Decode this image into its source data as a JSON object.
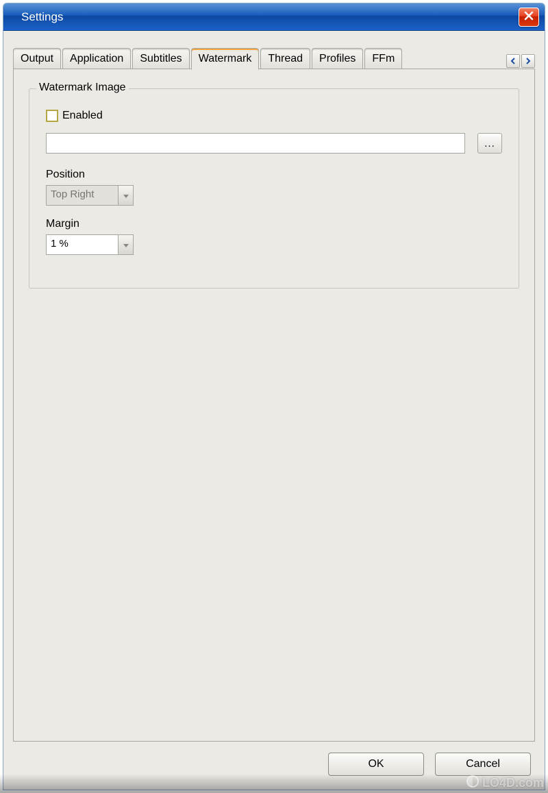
{
  "window": {
    "title": "Settings"
  },
  "tabs": {
    "items": [
      {
        "label": "Output"
      },
      {
        "label": "Application"
      },
      {
        "label": "Subtitles"
      },
      {
        "label": "Watermark"
      },
      {
        "label": "Thread"
      },
      {
        "label": "Profiles"
      },
      {
        "label": "FFm"
      }
    ],
    "active_index": 3
  },
  "watermark": {
    "group_title": "Watermark Image",
    "enabled_label": "Enabled",
    "enabled_value": false,
    "path_value": "",
    "browse_label": "...",
    "position_label": "Position",
    "position_value": "Top Right",
    "margin_label": "Margin",
    "margin_value": "1 %"
  },
  "buttons": {
    "ok": "OK",
    "cancel": "Cancel"
  },
  "brand": "LO4D.com"
}
